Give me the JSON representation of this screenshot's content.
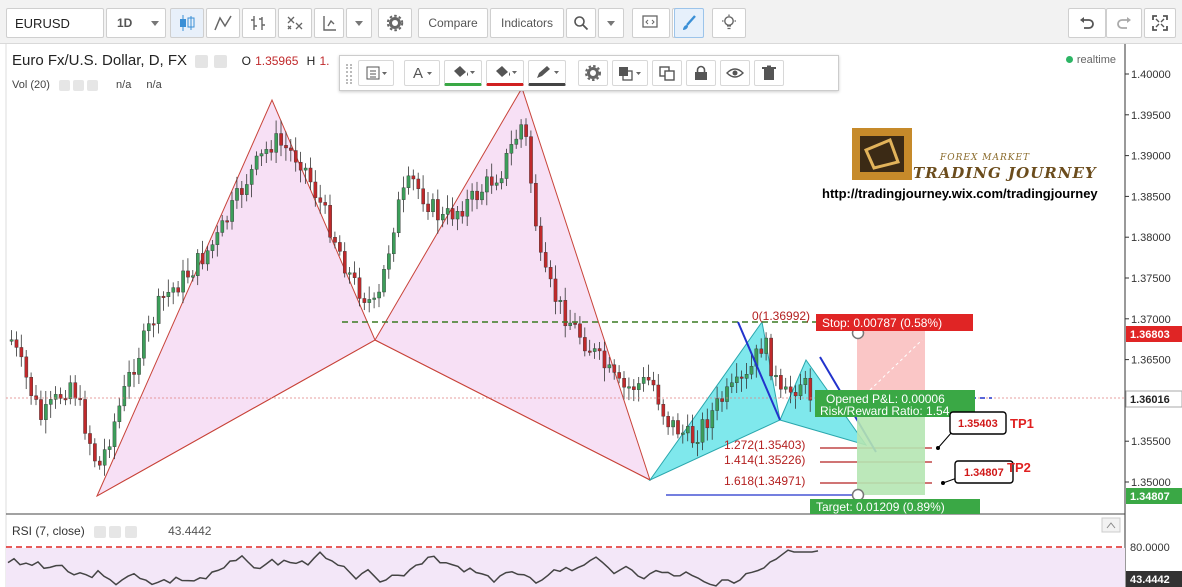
{
  "toolbar": {
    "symbol": "EURUSD",
    "interval": "1D",
    "compare_label": "Compare",
    "indicators_label": "Indicators"
  },
  "legend": {
    "title": "Euro Fx/U.S. Dollar, D, FX",
    "open_label": "O",
    "open_value": "1.35965",
    "high_label": "H",
    "high_value": "1.",
    "vol_label": "Vol (20)",
    "vol_na1": "n/a",
    "vol_na2": "n/a",
    "realtime": "realtime"
  },
  "watermark": {
    "line1": "FOREX MARKET",
    "line2": "TRADING JOURNEY",
    "url": "http://tradingjourney.wix.com/tradingjourney"
  },
  "trade": {
    "stop": "Stop: 0.00787 (0.58%)",
    "opened_pl": "Opened P&L: 0.00006",
    "risk_reward": "Risk/Reward Ratio: 1.54",
    "target": "Target: 0.01209 (0.89%)",
    "fib_0": "0(1.36992)",
    "fib_1272": "1.272(1.35403)",
    "fib_1414": "1.414(1.35226)",
    "fib_1618": "1.618(1.34971)",
    "tp1_value": "1.35403",
    "tp1_label": "TP1",
    "tp2_value": "1.34807",
    "tp2_label": "TP2"
  },
  "price_axis": {
    "ticks": [
      "1.40000",
      "1.39500",
      "1.39000",
      "1.38500",
      "1.38000",
      "1.37500",
      "1.37000",
      "1.36500",
      "1.36000",
      "1.35500",
      "1.35000"
    ],
    "tag_stop": "1.36803",
    "tag_current": "1.36016",
    "tag_target": "1.34807"
  },
  "rsi": {
    "label": "RSI (7, close)",
    "value": "43.4442",
    "tick": "80.0000",
    "tag": "43.4442"
  },
  "colors": {
    "up": "#3c9e5a",
    "down": "#c0292b",
    "harmonic_fill": "#f7e0f5",
    "harmonic_line": "#c8443a",
    "cyan_fill": "#7fe8ec",
    "accent_green": "#3aa845",
    "accent_red": "#e02525"
  }
}
